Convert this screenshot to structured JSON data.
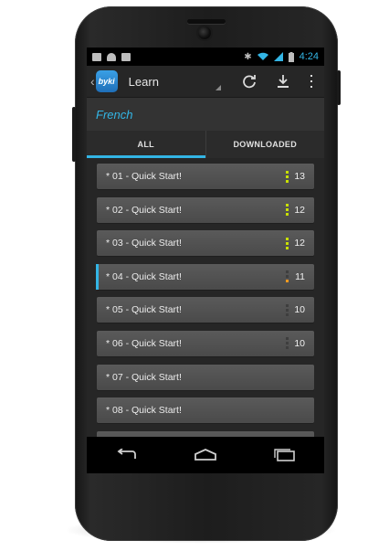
{
  "statusbar": {
    "time": "4:24",
    "left_icons": [
      "image-icon",
      "android-icon",
      "store-icon"
    ],
    "right_icons": [
      "bluetooth-icon",
      "wifi-icon",
      "signal-icon",
      "battery-icon"
    ]
  },
  "actionbar": {
    "title": "Learn",
    "actions": [
      "refresh-icon",
      "download-icon",
      "overflow-menu-icon"
    ],
    "logo_text": "byki"
  },
  "subheader": {
    "language": "French"
  },
  "tabs": [
    {
      "label": "ALL",
      "active": true
    },
    {
      "label": "DOWNLOADED",
      "active": false
    }
  ],
  "list": [
    {
      "label": "* 01 - Quick Start!",
      "count": "13",
      "level": 3,
      "color": "green",
      "selected": false
    },
    {
      "label": "* 02 - Quick Start!",
      "count": "12",
      "level": 3,
      "color": "green",
      "selected": false
    },
    {
      "label": "* 03 - Quick Start!",
      "count": "12",
      "level": 3,
      "color": "green",
      "selected": false
    },
    {
      "label": "* 04 - Quick Start!",
      "count": "11",
      "level": 1,
      "color": "orange",
      "selected": true
    },
    {
      "label": "* 05 - Quick Start!",
      "count": "10",
      "level": 0,
      "color": "none",
      "selected": false
    },
    {
      "label": "* 06 - Quick Start!",
      "count": "10",
      "level": 0,
      "color": "none",
      "selected": false
    },
    {
      "label": "* 07 - Quick Start!",
      "count": "",
      "level": -1,
      "color": "none",
      "selected": false
    },
    {
      "label": "* 08 - Quick Start!",
      "count": "",
      "level": -1,
      "color": "none",
      "selected": false
    },
    {
      "label": "",
      "count": "",
      "level": -1,
      "color": "none",
      "selected": false
    }
  ],
  "navbar": [
    "back-icon",
    "home-icon",
    "recents-icon"
  ],
  "colors": {
    "accent": "#33b5e5",
    "green": "#c8e000",
    "orange": "#ff9a1f"
  }
}
